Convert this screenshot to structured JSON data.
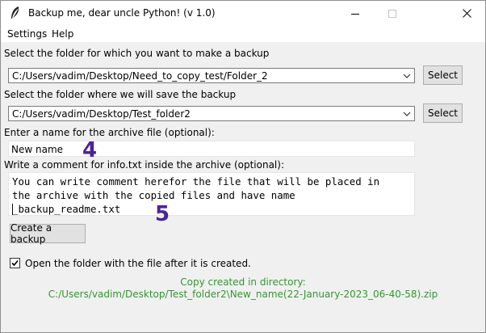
{
  "window": {
    "title": "Backup me, dear uncle Python! (v 1.0)",
    "icon": "feather-icon"
  },
  "menu": {
    "items": [
      "Settings",
      "Help"
    ]
  },
  "source": {
    "label": "Select the folder for which you want to make a backup",
    "value": "C:/Users/vadim/Desktop/Need_to_copy_test/Folder_2",
    "button": "Select"
  },
  "destination": {
    "label": "Select the folder where we will save the backup",
    "value": "C:/Users/vadim/Desktop/Test_folder2",
    "button": "Select"
  },
  "archive_name": {
    "label": "Enter a name for the archive file (optional):",
    "value": "New name"
  },
  "comment": {
    "label": "Write a comment for info.txt inside the archive (optional):",
    "lines": [
      "You can write comment herefor the file that will be placed in",
      "the archive with the copied files and have name",
      "_backup_readme.txt"
    ]
  },
  "create_button": "Create a backup",
  "open_folder": {
    "label": "Open the folder with the file after it is created.",
    "checked": true
  },
  "status": {
    "line1": "Copy created in directory:",
    "line2": "C:/Users/vadim/Desktop/Test_folder2\\New_name(22-January-2023_06-40-58).zip",
    "color": "#2e9a2e"
  },
  "annotations": [
    "4",
    "5"
  ]
}
